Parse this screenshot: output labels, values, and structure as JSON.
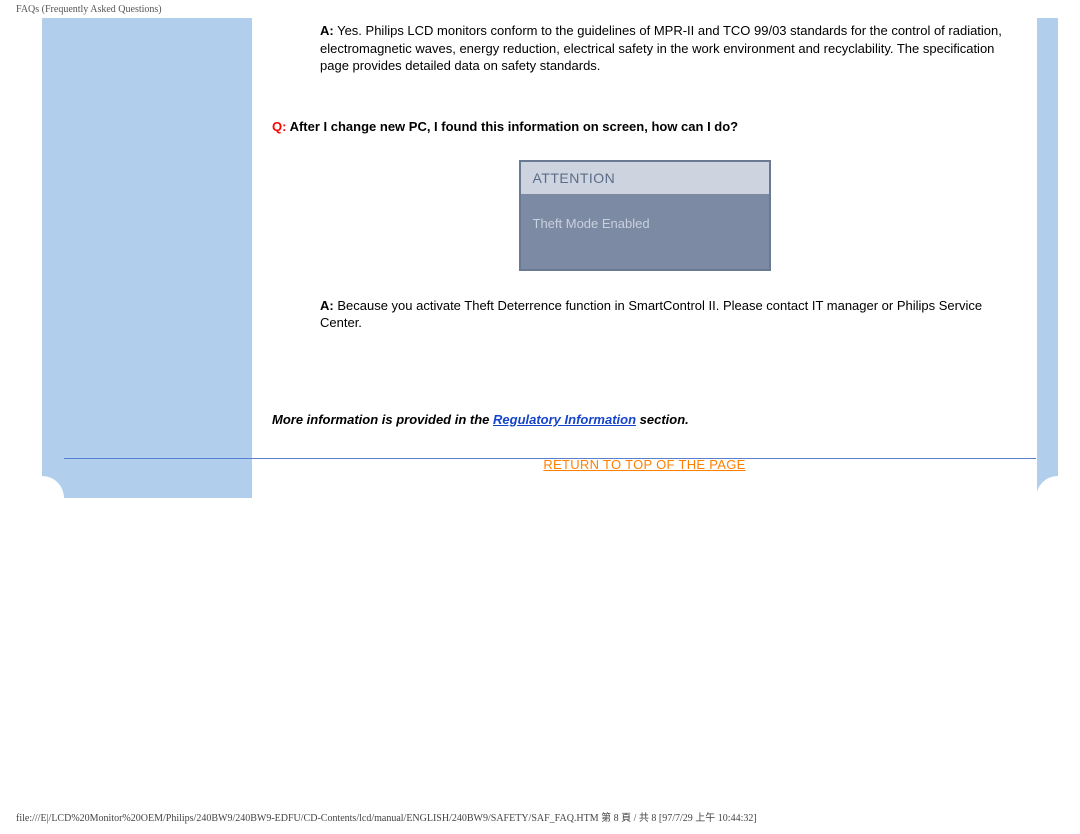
{
  "page_title": "FAQs (Frequently Asked Questions)",
  "qa1": {
    "a_label": "A:",
    "a_text": " Yes. Philips LCD monitors conform to the guidelines of MPR-II and TCO 99/03 standards for the control of radiation, electromagnetic waves, energy reduction, electrical safety in the work environment and recyclability. The specification page provides detailed data on safety standards."
  },
  "qa2": {
    "q_label": "Q:",
    "q_text": " After I change new PC, I found this information on screen, how can I do?",
    "dialog_header": "ATTENTION",
    "dialog_body": "Theft Mode Enabled",
    "a_label": "A:",
    "a_text": " Because you activate Theft Deterrence function in SmartControl II. Please contact IT manager or Philips Service Center."
  },
  "more_info_pre": "More information is provided in the ",
  "more_info_link": "Regulatory Information",
  "more_info_post": " section.",
  "return_link": "RETURN TO TOP OF THE PAGE",
  "footer_path": "file:///E|/LCD%20Monitor%20OEM/Philips/240BW9/240BW9-EDFU/CD-Contents/lcd/manual/ENGLISH/240BW9/SAFETY/SAF_FAQ.HTM 第 8 頁 / 共 8  [97/7/29 上午 10:44:32]"
}
